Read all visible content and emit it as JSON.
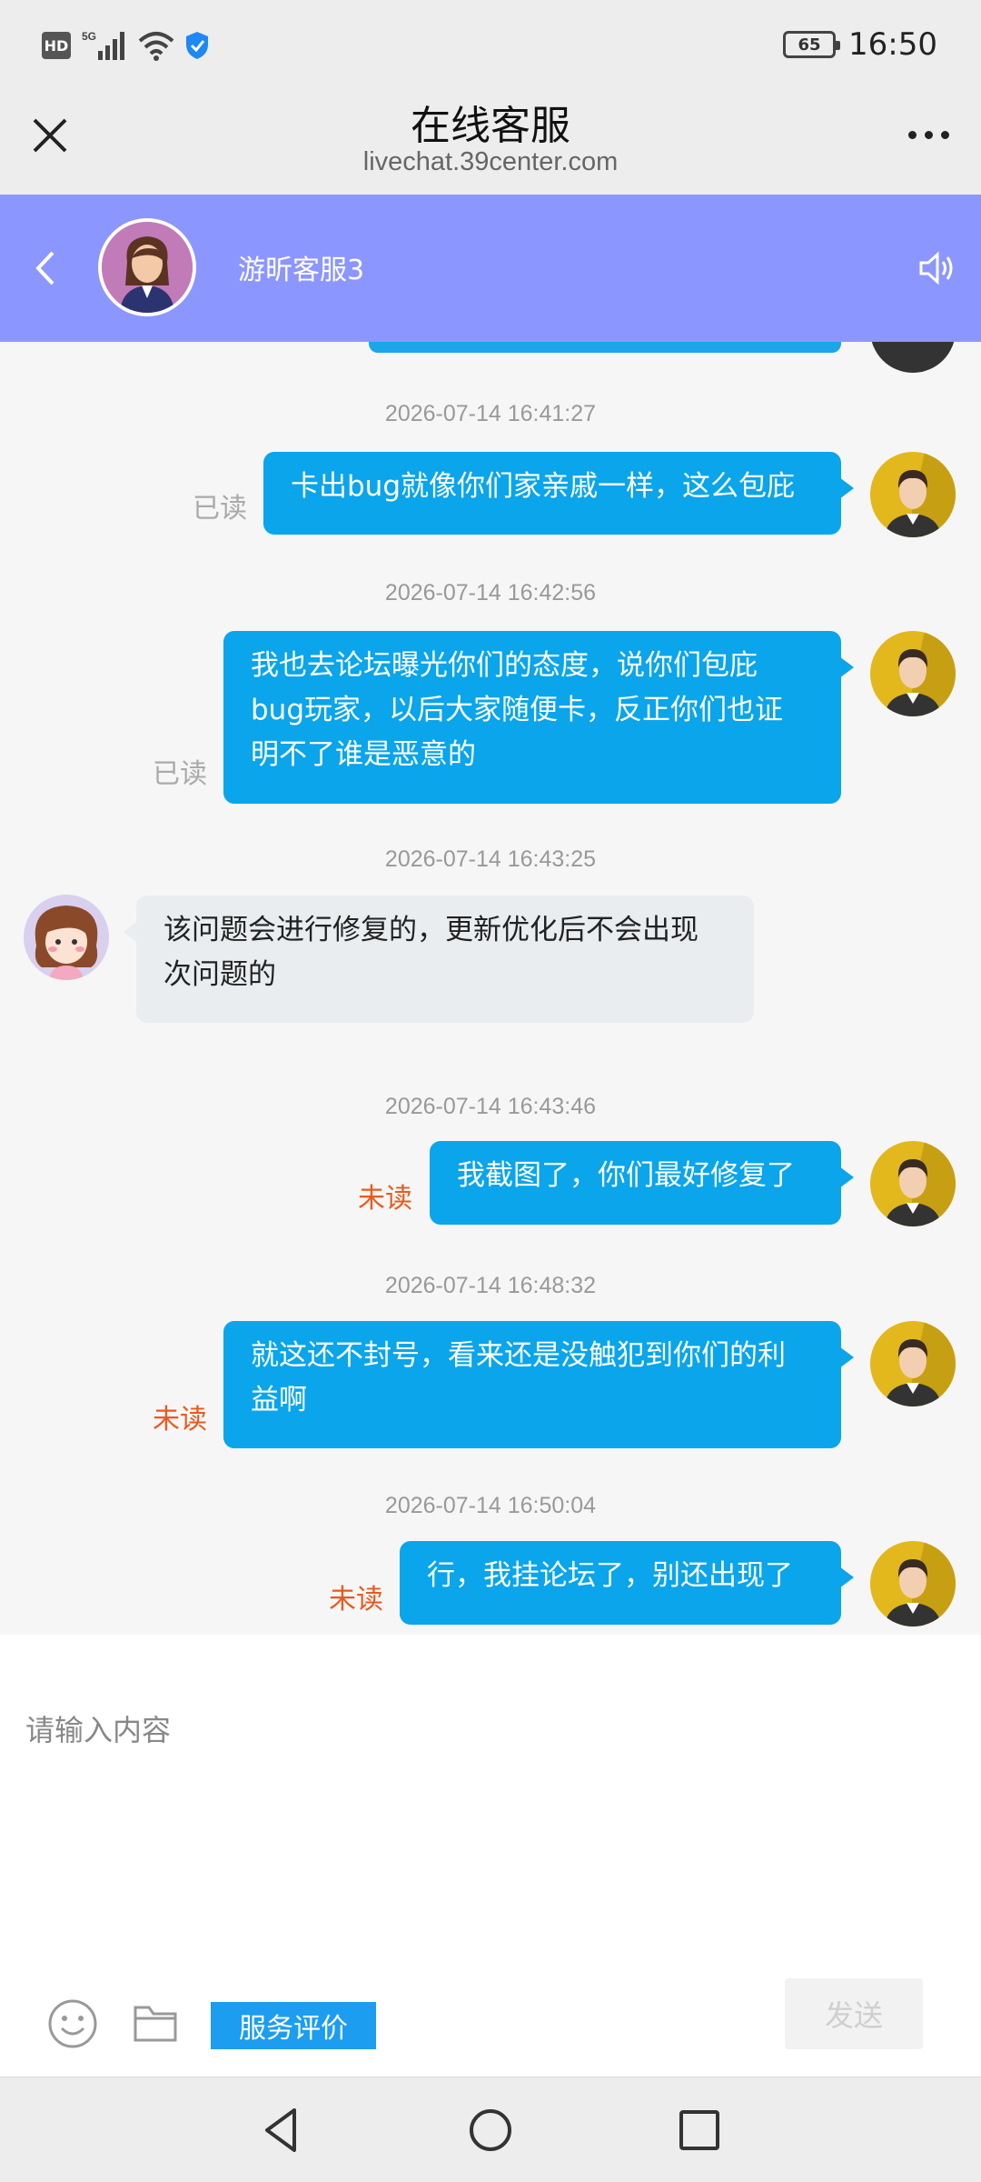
{
  "status_bar": {
    "hd_label": "HD",
    "network": "5G",
    "battery": "65",
    "time": "16:50"
  },
  "title_bar": {
    "title": "在线客服",
    "url": "livechat.39center.com"
  },
  "agent": {
    "name": "游昕客服3",
    "header_color": "#8c96ff"
  },
  "messages": [
    {
      "time": "2026-07-14 16:41:27",
      "sender": "user",
      "lines": [
        "卡出bug就像你们家亲戚一样，这么包庇"
      ],
      "status": "已读"
    },
    {
      "time": "2026-07-14 16:42:56",
      "sender": "user",
      "lines": [
        "我也去论坛曝光你们的态度，说你们包庇",
        "bug玩家，以后大家随便卡，反正你们也证",
        "明不了谁是恶意的"
      ],
      "status": "已读"
    },
    {
      "time": "2026-07-14 16:43:25",
      "sender": "agent",
      "lines": [
        "该问题会进行修复的，更新优化后不会出现",
        "次问题的"
      ]
    },
    {
      "time": "2026-07-14 16:43:46",
      "sender": "user",
      "lines": [
        "我截图了，你们最好修复了"
      ],
      "status": "未读"
    },
    {
      "time": "2026-07-14 16:48:32",
      "sender": "user",
      "lines": [
        "就这还不封号，看来还是没触犯到你们的利",
        "益啊"
      ],
      "status": "未读"
    },
    {
      "time": "2026-07-14 16:50:04",
      "sender": "user",
      "lines": [
        "行，我挂论坛了，别还出现了"
      ],
      "status": "未读"
    }
  ],
  "input": {
    "placeholder": "请输入内容"
  },
  "toolbar": {
    "rate_label": "服务评价",
    "send_label": "发送"
  },
  "colors": {
    "bubble_out": "#0aa5eb",
    "bubble_in": "#e9edf0",
    "unread": "#e85a1f",
    "read": "#aaaaaa"
  }
}
